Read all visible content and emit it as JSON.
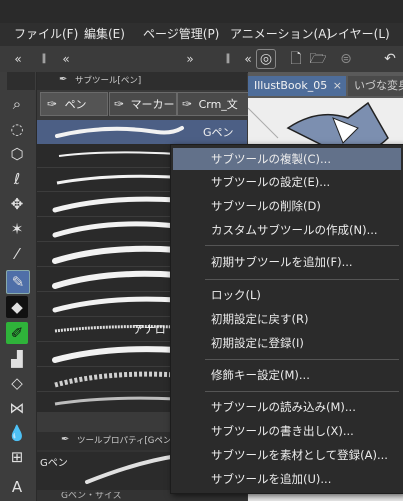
{
  "menubar": {
    "items": [
      "ファイル(F)",
      "編集(E)",
      "ページ管理(P)",
      "アニメーション(A)",
      "レイヤー(L)"
    ]
  },
  "subtool_panel": {
    "tab_label": "サブツール[ペン]",
    "groups": [
      "ペン",
      "マーカー",
      "Crm_文"
    ],
    "selected_brush_label": "Gペン",
    "partial_brush_label": "アナロ"
  },
  "tool_property": {
    "header_label": "ツールプロパティ[Gペン]",
    "preview_label": "Gペン",
    "bottom_label": "Gペン・サイズ"
  },
  "canvas": {
    "active_tab": "IllustBook_05",
    "inactive_tab": "いづな変身"
  },
  "context_menu": {
    "items": [
      {
        "label": "サブツールの複製(C)...",
        "hover": true
      },
      {
        "label": "サブツールの設定(E)..."
      },
      {
        "label": "サブツールの削除(D)"
      },
      {
        "label": "カスタムサブツールの作成(N)..."
      },
      {
        "sep": true
      },
      {
        "label": "初期サブツールを追加(F)..."
      },
      {
        "sep": true
      },
      {
        "label": "ロック(L)"
      },
      {
        "label": "初期設定に戻す(R)"
      },
      {
        "label": "初期設定に登録(I)"
      },
      {
        "sep": true
      },
      {
        "label": "修飾キー設定(M)..."
      },
      {
        "sep": true
      },
      {
        "label": "サブツールの読み込み(M)..."
      },
      {
        "label": "サブツールの書き出し(X)..."
      },
      {
        "label": "サブツールを素材として登録(A)..."
      },
      {
        "label": "サブツールを追加(U)..."
      }
    ]
  },
  "icons": {
    "left_toolbar": [
      "zoom-icon",
      "lasso-select-icon",
      "3d-box-icon",
      "lasso-icon",
      "move-icon",
      "magic-wand-icon",
      "eyedropper-icon",
      "pen-icon",
      "marker-icon",
      "airbrush-icon",
      "fill-icon",
      "eraser-icon",
      "decoration-icon",
      "blend-icon",
      "grid-icon",
      "text-icon"
    ]
  }
}
